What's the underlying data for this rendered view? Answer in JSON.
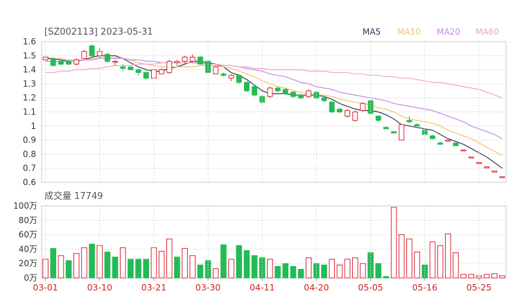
{
  "header": {
    "title": "[SZ002113] 2023-05-31",
    "volume_label": "成交量 17749"
  },
  "legend": [
    {
      "name": "MA5",
      "color": "#333355"
    },
    {
      "name": "MA10",
      "color": "#f5c06a"
    },
    {
      "name": "MA20",
      "color": "#c38ae0"
    },
    {
      "name": "MA60",
      "color": "#f2a3c9"
    }
  ],
  "colors": {
    "up": "#dd2233",
    "down": "#22bb55"
  },
  "chart_data": [
    {
      "type": "candlestick",
      "title": "[SZ002113] 2023-05-31",
      "ylim": [
        0.6,
        1.6
      ],
      "yticks": [
        "1.6",
        "1.5",
        "1.4",
        "1.3",
        "1.2",
        "1.1",
        "1",
        "0.9",
        "0.8",
        "0.7",
        "0.6"
      ],
      "xticks": [
        {
          "label": "03-01",
          "index": 0
        },
        {
          "label": "03-10",
          "index": 7
        },
        {
          "label": "03-21",
          "index": 14
        },
        {
          "label": "03-30",
          "index": 21
        },
        {
          "label": "04-11",
          "index": 28
        },
        {
          "label": "04-20",
          "index": 35
        },
        {
          "label": "05-05",
          "index": 42
        },
        {
          "label": "05-16",
          "index": 49
        },
        {
          "label": "05-25",
          "index": 56
        }
      ],
      "candles": [
        [
          1.47,
          1.49,
          1.5,
          1.47
        ],
        [
          1.48,
          1.43,
          1.49,
          1.42
        ],
        [
          1.46,
          1.44,
          1.47,
          1.43
        ],
        [
          1.46,
          1.44,
          1.47,
          1.43
        ],
        [
          1.44,
          1.47,
          1.48,
          1.43
        ],
        [
          1.48,
          1.53,
          1.54,
          1.48
        ],
        [
          1.57,
          1.5,
          1.58,
          1.49
        ],
        [
          1.5,
          1.53,
          1.56,
          1.48
        ],
        [
          1.51,
          1.46,
          1.52,
          1.45
        ],
        [
          1.46,
          1.46,
          1.47,
          1.43
        ],
        [
          1.42,
          1.41,
          1.44,
          1.39
        ],
        [
          1.42,
          1.4,
          1.42,
          1.4
        ],
        [
          1.4,
          1.38,
          1.41,
          1.36
        ],
        [
          1.38,
          1.34,
          1.39,
          1.33
        ],
        [
          1.34,
          1.4,
          1.4,
          1.34
        ],
        [
          1.37,
          1.4,
          1.41,
          1.37
        ],
        [
          1.38,
          1.46,
          1.47,
          1.37
        ],
        [
          1.45,
          1.46,
          1.47,
          1.43
        ],
        [
          1.46,
          1.49,
          1.5,
          1.45
        ],
        [
          1.46,
          1.49,
          1.51,
          1.45
        ],
        [
          1.49,
          1.44,
          1.5,
          1.44
        ],
        [
          1.46,
          1.38,
          1.47,
          1.37
        ],
        [
          1.37,
          1.42,
          1.43,
          1.37
        ],
        [
          1.37,
          1.36,
          1.38,
          1.35
        ],
        [
          1.34,
          1.36,
          1.37,
          1.32
        ],
        [
          1.36,
          1.31,
          1.37,
          1.3
        ],
        [
          1.31,
          1.25,
          1.32,
          1.24
        ],
        [
          1.28,
          1.22,
          1.29,
          1.21
        ],
        [
          1.21,
          1.17,
          1.22,
          1.16
        ],
        [
          1.21,
          1.27,
          1.28,
          1.2
        ],
        [
          1.27,
          1.25,
          1.28,
          1.24
        ],
        [
          1.26,
          1.23,
          1.27,
          1.22
        ],
        [
          1.24,
          1.21,
          1.25,
          1.2
        ],
        [
          1.22,
          1.2,
          1.23,
          1.19
        ],
        [
          1.21,
          1.25,
          1.26,
          1.2
        ],
        [
          1.24,
          1.2,
          1.25,
          1.19
        ],
        [
          1.2,
          1.18,
          1.21,
          1.17
        ],
        [
          1.17,
          1.1,
          1.18,
          1.09
        ],
        [
          1.12,
          1.1,
          1.13,
          1.09
        ],
        [
          1.07,
          1.11,
          1.12,
          1.06
        ],
        [
          1.04,
          1.1,
          1.11,
          1.03
        ],
        [
          1.11,
          1.16,
          1.17,
          1.1
        ],
        [
          1.18,
          1.09,
          1.19,
          1.08
        ],
        [
          1.07,
          1.04,
          1.08,
          1.03
        ],
        [
          0.99,
          0.98,
          1.0,
          0.98
        ],
        [
          0.96,
          0.95,
          0.96,
          0.95
        ],
        [
          0.9,
          1.01,
          1.01,
          0.9
        ],
        [
          1.04,
          1.03,
          1.07,
          1.02
        ],
        [
          1.01,
          1.0,
          1.02,
          1.0
        ],
        [
          0.97,
          0.94,
          0.97,
          0.94
        ],
        [
          0.93,
          0.91,
          0.94,
          0.91
        ],
        [
          0.88,
          0.87,
          0.89,
          0.87
        ],
        [
          0.9,
          0.9,
          0.9,
          0.9
        ],
        [
          0.88,
          0.86,
          0.88,
          0.86
        ],
        [
          0.83,
          0.83,
          0.83,
          0.83
        ],
        [
          0.78,
          0.78,
          0.78,
          0.78
        ],
        [
          0.74,
          0.74,
          0.74,
          0.74
        ],
        [
          0.71,
          0.71,
          0.71,
          0.71
        ],
        [
          0.68,
          0.68,
          0.68,
          0.68
        ],
        [
          0.64,
          0.64,
          0.64,
          0.64
        ]
      ],
      "series": [
        {
          "name": "MA5",
          "color": "#333355",
          "values": [
            1.48,
            1.48,
            1.47,
            1.46,
            1.46,
            1.47,
            1.49,
            1.5,
            1.5,
            1.5,
            1.48,
            1.45,
            1.42,
            1.4,
            1.39,
            1.39,
            1.41,
            1.42,
            1.44,
            1.46,
            1.46,
            1.45,
            1.44,
            1.42,
            1.38,
            1.36,
            1.33,
            1.29,
            1.25,
            1.23,
            1.23,
            1.23,
            1.22,
            1.22,
            1.22,
            1.22,
            1.21,
            1.19,
            1.16,
            1.14,
            1.12,
            1.11,
            1.11,
            1.1,
            1.08,
            1.05,
            1.01,
            1.0,
            0.99,
            0.98,
            0.97,
            0.94,
            0.91,
            0.89,
            0.87,
            0.84,
            0.81,
            0.78,
            0.74,
            0.7
          ]
        },
        {
          "name": "MA10",
          "color": "#f5c06a",
          "values": [
            1.49,
            1.48,
            1.48,
            1.47,
            1.47,
            1.47,
            1.48,
            1.49,
            1.49,
            1.49,
            1.48,
            1.47,
            1.45,
            1.44,
            1.43,
            1.42,
            1.42,
            1.42,
            1.42,
            1.42,
            1.43,
            1.43,
            1.43,
            1.42,
            1.41,
            1.39,
            1.37,
            1.35,
            1.32,
            1.3,
            1.28,
            1.27,
            1.25,
            1.24,
            1.23,
            1.22,
            1.22,
            1.21,
            1.19,
            1.18,
            1.17,
            1.16,
            1.15,
            1.13,
            1.12,
            1.1,
            1.07,
            1.05,
            1.04,
            1.03,
            1.02,
            1.0,
            0.97,
            0.95,
            0.93,
            0.91,
            0.88,
            0.85,
            0.82,
            0.79
          ]
        },
        {
          "name": "MA20",
          "color": "#c38ae0",
          "values": [
            1.46,
            1.46,
            1.46,
            1.46,
            1.46,
            1.47,
            1.47,
            1.48,
            1.48,
            1.48,
            1.48,
            1.47,
            1.47,
            1.46,
            1.46,
            1.45,
            1.45,
            1.45,
            1.45,
            1.45,
            1.45,
            1.44,
            1.44,
            1.43,
            1.43,
            1.42,
            1.41,
            1.4,
            1.39,
            1.37,
            1.36,
            1.35,
            1.33,
            1.31,
            1.3,
            1.28,
            1.27,
            1.26,
            1.24,
            1.23,
            1.22,
            1.21,
            1.2,
            1.19,
            1.18,
            1.16,
            1.15,
            1.14,
            1.13,
            1.12,
            1.11,
            1.09,
            1.07,
            1.05,
            1.03,
            1.0,
            0.98,
            0.96,
            0.94,
            0.91
          ]
        },
        {
          "name": "MA60",
          "color": "#f2a3c9",
          "values": [
            1.38,
            1.38,
            1.39,
            1.39,
            1.4,
            1.4,
            1.41,
            1.41,
            1.42,
            1.43,
            1.43,
            1.43,
            1.44,
            1.44,
            1.44,
            1.45,
            1.45,
            1.45,
            1.45,
            1.45,
            1.44,
            1.44,
            1.44,
            1.43,
            1.43,
            1.42,
            1.42,
            1.41,
            1.41,
            1.4,
            1.4,
            1.4,
            1.4,
            1.4,
            1.39,
            1.39,
            1.39,
            1.38,
            1.38,
            1.38,
            1.37,
            1.37,
            1.36,
            1.36,
            1.35,
            1.35,
            1.34,
            1.34,
            1.33,
            1.32,
            1.31,
            1.31,
            1.3,
            1.29,
            1.28,
            1.27,
            1.26,
            1.24,
            1.22,
            1.2
          ]
        }
      ]
    },
    {
      "type": "bar",
      "title": "成交量 17749",
      "ylim": [
        0,
        100
      ],
      "yticks": [
        "100万",
        "80万",
        "60万",
        "40万",
        "20万",
        "0万"
      ],
      "volume_10k": [
        26,
        41,
        31,
        24,
        34,
        42,
        47,
        45,
        36,
        29,
        42,
        26,
        26,
        26,
        42,
        37,
        54,
        29,
        41,
        31,
        18,
        24,
        13,
        46,
        26,
        45,
        38,
        31,
        28,
        26,
        16,
        20,
        16,
        12,
        28,
        20,
        18,
        26,
        18,
        26,
        28,
        20,
        35,
        20,
        2,
        98,
        60,
        54,
        36,
        18,
        50,
        45,
        61,
        35,
        5,
        5,
        3,
        5,
        6,
        3
      ],
      "up": [
        1,
        0,
        1,
        0,
        1,
        1,
        0,
        1,
        0,
        0,
        1,
        0,
        0,
        0,
        1,
        1,
        1,
        0,
        1,
        1,
        0,
        0,
        1,
        0,
        1,
        0,
        0,
        0,
        0,
        1,
        0,
        0,
        0,
        0,
        1,
        0,
        0,
        1,
        1,
        1,
        1,
        1,
        0,
        0,
        0,
        1,
        1,
        1,
        1,
        0,
        1,
        1,
        1,
        1,
        1,
        1,
        1,
        1,
        1,
        1
      ]
    }
  ]
}
